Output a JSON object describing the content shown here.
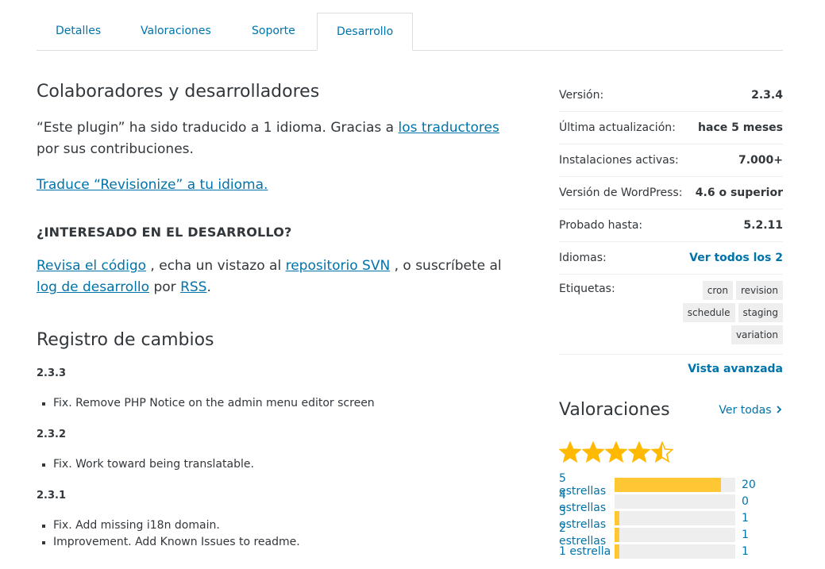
{
  "tabs": [
    {
      "label": "Detalles"
    },
    {
      "label": "Valoraciones"
    },
    {
      "label": "Soporte"
    },
    {
      "label": "Desarrollo"
    }
  ],
  "main": {
    "contributors_heading": "Colaboradores y desarrolladores",
    "translated_prefix": "“Este plugin” ha sido traducido a 1 idioma. Gracias a",
    "translators_link": "los traductores",
    "translated_suffix": "por sus contribuciones.",
    "translate_link": "Traduce “Revisionize” a tu idioma.",
    "dev_heading": "¿INTERESADO EN EL DESARROLLO?",
    "dev_link_code": "Revisa el código",
    "dev_text_1": ", echa un vistazo al",
    "dev_link_svn": "repositorio SVN",
    "dev_text_2": ", o suscríbete al",
    "dev_link_log": "log de desarrollo",
    "dev_text_3": "por",
    "dev_link_rss": "RSS",
    "dev_text_4": ".",
    "changelog_heading": "Registro de cambios",
    "changelog": [
      {
        "version": "2.3.3",
        "items": [
          "Fix. Remove PHP Notice on the admin menu editor screen"
        ]
      },
      {
        "version": "2.3.2",
        "items": [
          "Fix. Work toward being translatable."
        ]
      },
      {
        "version": "2.3.1",
        "items": [
          "Fix. Add missing i18n domain.",
          "Improvement. Add Known Issues to readme."
        ]
      }
    ]
  },
  "sidebar": {
    "meta": [
      {
        "label": "Versión:",
        "value": "2.3.4"
      },
      {
        "label": "Última actualización:",
        "value": "hace 5 meses"
      },
      {
        "label": "Instalaciones activas:",
        "value": "7.000+"
      },
      {
        "label": "Versión de WordPress:",
        "value": "4.6 o superior"
      },
      {
        "label": "Probado hasta:",
        "value": "5.2.11"
      },
      {
        "label": "Idiomas:",
        "value": "Ver todos los 2"
      }
    ],
    "tags_label": "Etiquetas:",
    "tags": [
      "cron",
      "revision",
      "schedule",
      "staging",
      "variation"
    ],
    "advanced_link": "Vista avanzada"
  },
  "ratings": {
    "heading": "Valoraciones",
    "see_all": "Ver todas",
    "see_all_icon": "chevron-right-icon",
    "average": 4.5,
    "star_color": "#ffb900",
    "bars": [
      {
        "label": "5 estrellas",
        "count": "20",
        "fraction": 0.88
      },
      {
        "label": "4 estrellas",
        "count": "0",
        "fraction": 0
      },
      {
        "label": "3 estrellas",
        "count": "1",
        "fraction": 0.04
      },
      {
        "label": "2 estrellas",
        "count": "1",
        "fraction": 0.04
      },
      {
        "label": "1 estrella",
        "count": "1",
        "fraction": 0.04
      }
    ]
  }
}
